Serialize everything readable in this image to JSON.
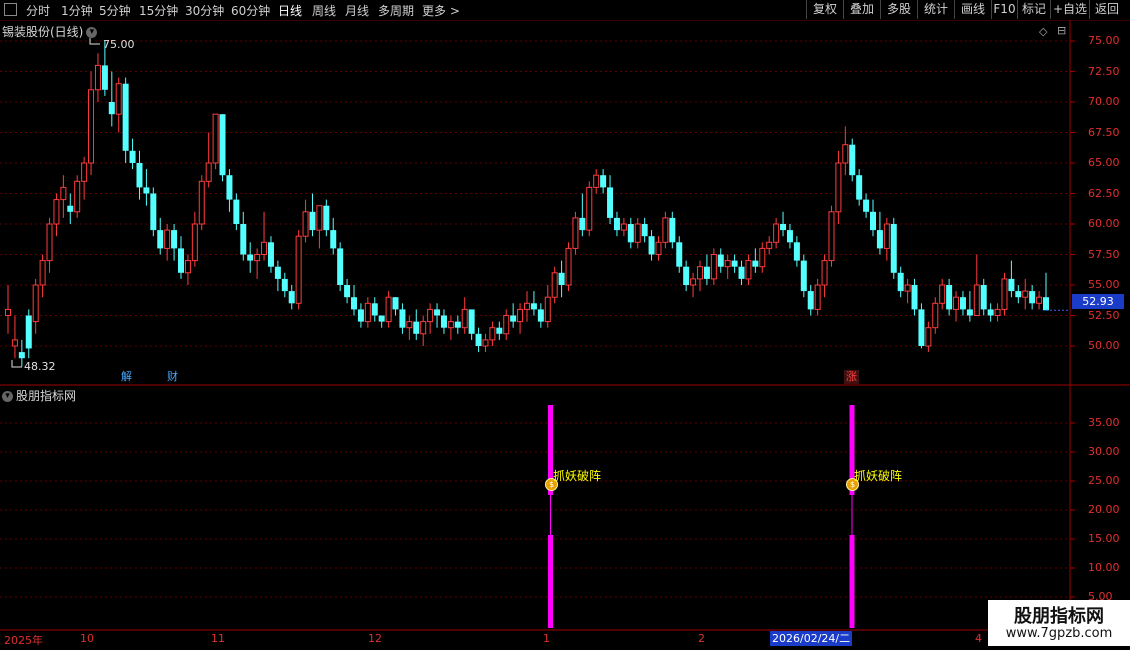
{
  "toolbar": {
    "timeframes": [
      "分时",
      "1分钟",
      "5分钟",
      "15分钟",
      "30分钟",
      "60分钟",
      "日线",
      "周线",
      "月线",
      "多周期",
      "更多 >"
    ],
    "active_timeframe": "日线",
    "right_buttons": [
      "复权",
      "叠加",
      "多股",
      "统计",
      "画线",
      "F10",
      "标记",
      "+自选",
      "返回"
    ]
  },
  "main_chart": {
    "title": "锡装股份(日线)",
    "high_label": "75.00",
    "low_label": "48.32",
    "current_price": "52.93",
    "y_ticks": [
      "75.00",
      "72.50",
      "70.00",
      "67.50",
      "65.00",
      "62.50",
      "60.00",
      "57.50",
      "55.00",
      "52.50",
      "50.00"
    ],
    "events": [
      {
        "text": "解",
        "color": "#4aa8ff"
      },
      {
        "text": "财",
        "color": "#4aa8ff"
      },
      {
        "text": "涨",
        "color": "#ff4040"
      }
    ],
    "candles": [
      [
        52.5,
        55.0,
        51.0,
        53.0
      ],
      [
        50.0,
        52.5,
        49.0,
        50.5
      ],
      [
        49.5,
        50.5,
        48.32,
        49.0
      ],
      [
        52.5,
        53.0,
        49.0,
        49.8
      ],
      [
        52.0,
        55.5,
        51.0,
        55.0
      ],
      [
        55.0,
        57.5,
        54.0,
        57.0
      ],
      [
        57.0,
        60.5,
        56.0,
        60.0
      ],
      [
        60.0,
        62.5,
        59.0,
        62.0
      ],
      [
        62.0,
        64.0,
        60.5,
        63.0
      ],
      [
        61.5,
        62.5,
        60.0,
        61.0
      ],
      [
        61.0,
        64.0,
        60.5,
        63.5
      ],
      [
        63.5,
        65.5,
        62.0,
        65.0
      ],
      [
        65.0,
        72.5,
        64.0,
        71.0
      ],
      [
        71.0,
        74.0,
        70.0,
        73.0
      ],
      [
        73.0,
        75.0,
        70.5,
        71.0
      ],
      [
        70.0,
        72.5,
        68.0,
        69.0
      ],
      [
        69.0,
        72.0,
        67.5,
        71.5
      ],
      [
        71.5,
        72.0,
        65.0,
        66.0
      ],
      [
        66.0,
        67.0,
        64.5,
        65.0
      ],
      [
        65.0,
        66.0,
        62.0,
        63.0
      ],
      [
        63.0,
        64.5,
        61.5,
        62.5
      ],
      [
        62.5,
        63.0,
        59.0,
        59.5
      ],
      [
        59.5,
        60.5,
        57.5,
        58.0
      ],
      [
        58.0,
        60.0,
        57.0,
        59.5
      ],
      [
        59.5,
        60.0,
        57.0,
        58.0
      ],
      [
        58.0,
        59.0,
        55.5,
        56.0
      ],
      [
        56.0,
        57.5,
        55.0,
        57.0
      ],
      [
        57.0,
        61.0,
        56.5,
        60.0
      ],
      [
        60.0,
        64.0,
        59.5,
        63.5
      ],
      [
        63.5,
        67.5,
        63.0,
        65.0
      ],
      [
        65.0,
        69.0,
        64.5,
        69.0
      ],
      [
        69.0,
        69.0,
        63.5,
        64.0
      ],
      [
        64.0,
        64.5,
        61.0,
        62.0
      ],
      [
        62.0,
        62.5,
        59.5,
        60.0
      ],
      [
        60.0,
        61.0,
        57.0,
        57.5
      ],
      [
        57.5,
        58.5,
        56.0,
        57.0
      ],
      [
        57.0,
        58.0,
        55.5,
        57.5
      ],
      [
        57.5,
        61.0,
        57.0,
        58.5
      ],
      [
        58.5,
        59.0,
        56.0,
        56.5
      ],
      [
        56.5,
        57.0,
        54.5,
        55.5
      ],
      [
        55.5,
        56.0,
        54.0,
        54.5
      ],
      [
        54.5,
        55.0,
        53.0,
        53.5
      ],
      [
        53.5,
        59.5,
        53.0,
        59.0
      ],
      [
        59.0,
        62.0,
        58.5,
        61.0
      ],
      [
        61.0,
        62.5,
        59.0,
        59.5
      ],
      [
        59.5,
        61.0,
        58.0,
        61.5
      ],
      [
        61.5,
        62.0,
        59.0,
        59.5
      ],
      [
        59.5,
        60.5,
        57.5,
        58.0
      ],
      [
        58.0,
        58.5,
        54.5,
        55.0
      ],
      [
        55.0,
        55.5,
        53.5,
        54.0
      ],
      [
        54.0,
        55.0,
        52.5,
        53.0
      ],
      [
        53.0,
        53.5,
        51.5,
        52.0
      ],
      [
        52.0,
        54.0,
        51.5,
        53.5
      ],
      [
        53.5,
        54.0,
        52.0,
        52.5
      ],
      [
        52.5,
        52.5,
        51.5,
        52.0
      ],
      [
        52.0,
        54.5,
        51.5,
        54.0
      ],
      [
        54.0,
        54.0,
        52.5,
        53.0
      ],
      [
        53.0,
        53.5,
        51.0,
        51.5
      ],
      [
        51.5,
        52.5,
        50.5,
        52.0
      ],
      [
        52.0,
        53.0,
        50.5,
        51.0
      ],
      [
        51.0,
        52.5,
        50.0,
        52.0
      ],
      [
        52.0,
        53.5,
        51.0,
        53.0
      ],
      [
        53.0,
        53.5,
        51.5,
        52.5
      ],
      [
        52.5,
        53.0,
        51.0,
        51.5
      ],
      [
        51.5,
        52.5,
        50.5,
        52.0
      ],
      [
        52.0,
        52.5,
        51.0,
        51.5
      ],
      [
        51.5,
        54.0,
        51.0,
        53.0
      ],
      [
        53.0,
        53.0,
        50.5,
        51.0
      ],
      [
        51.0,
        51.5,
        49.5,
        50.0
      ],
      [
        50.0,
        51.0,
        49.5,
        50.5
      ],
      [
        50.5,
        52.0,
        50.0,
        51.5
      ],
      [
        51.5,
        52.0,
        50.5,
        51.0
      ],
      [
        51.0,
        53.0,
        50.5,
        52.5
      ],
      [
        52.5,
        53.5,
        51.5,
        52.0
      ],
      [
        52.0,
        53.5,
        51.0,
        53.0
      ],
      [
        53.0,
        54.5,
        52.0,
        53.5
      ],
      [
        53.5,
        54.5,
        52.5,
        53.0
      ],
      [
        53.0,
        53.5,
        51.5,
        52.0
      ],
      [
        52.0,
        55.0,
        51.5,
        54.0
      ],
      [
        54.0,
        56.5,
        53.5,
        56.0
      ],
      [
        56.0,
        57.0,
        54.0,
        55.0
      ],
      [
        55.0,
        58.5,
        54.5,
        58.0
      ],
      [
        58.0,
        61.0,
        57.5,
        60.5
      ],
      [
        60.5,
        62.5,
        59.0,
        59.5
      ],
      [
        59.5,
        63.5,
        59.0,
        63.0
      ],
      [
        63.0,
        64.5,
        62.5,
        64.0
      ],
      [
        64.0,
        64.5,
        62.5,
        63.0
      ],
      [
        63.0,
        64.0,
        60.0,
        60.5
      ],
      [
        60.5,
        61.0,
        59.0,
        59.5
      ],
      [
        59.5,
        60.5,
        59.0,
        60.0
      ],
      [
        60.0,
        60.5,
        58.0,
        58.5
      ],
      [
        58.5,
        60.5,
        58.0,
        60.0
      ],
      [
        60.0,
        60.5,
        58.5,
        59.0
      ],
      [
        59.0,
        59.5,
        57.0,
        57.5
      ],
      [
        57.5,
        59.0,
        57.0,
        58.5
      ],
      [
        58.5,
        61.0,
        58.0,
        60.5
      ],
      [
        60.5,
        61.0,
        58.0,
        58.5
      ],
      [
        58.5,
        59.0,
        56.0,
        56.5
      ],
      [
        56.5,
        57.0,
        54.5,
        55.0
      ],
      [
        55.0,
        56.0,
        54.0,
        55.5
      ],
      [
        55.5,
        57.0,
        54.5,
        56.5
      ],
      [
        56.5,
        57.5,
        55.0,
        55.5
      ],
      [
        55.5,
        58.0,
        55.0,
        57.5
      ],
      [
        57.5,
        58.0,
        56.0,
        56.5
      ],
      [
        56.5,
        57.5,
        55.5,
        57.0
      ],
      [
        57.0,
        57.5,
        56.0,
        56.5
      ],
      [
        56.5,
        57.0,
        55.0,
        55.5
      ],
      [
        55.5,
        57.5,
        55.0,
        57.0
      ],
      [
        57.0,
        58.0,
        56.0,
        56.5
      ],
      [
        56.5,
        58.5,
        56.0,
        58.0
      ],
      [
        58.0,
        59.0,
        57.5,
        58.5
      ],
      [
        58.5,
        60.5,
        58.0,
        60.0
      ],
      [
        60.0,
        61.0,
        59.0,
        59.5
      ],
      [
        59.5,
        60.0,
        58.0,
        58.5
      ],
      [
        58.5,
        59.0,
        56.5,
        57.0
      ],
      [
        57.0,
        57.5,
        54.0,
        54.5
      ],
      [
        54.5,
        55.0,
        52.5,
        53.0
      ],
      [
        53.0,
        55.5,
        52.5,
        55.0
      ],
      [
        55.0,
        57.5,
        54.0,
        57.0
      ],
      [
        57.0,
        61.5,
        56.5,
        61.0
      ],
      [
        61.0,
        66.0,
        60.0,
        65.0
      ],
      [
        65.0,
        68.0,
        64.0,
        66.5
      ],
      [
        66.5,
        67.0,
        63.5,
        64.0
      ],
      [
        64.0,
        64.5,
        61.5,
        62.0
      ],
      [
        62.0,
        62.5,
        60.5,
        61.0
      ],
      [
        61.0,
        62.0,
        59.0,
        59.5
      ],
      [
        59.5,
        61.0,
        57.5,
        58.0
      ],
      [
        58.0,
        60.5,
        57.0,
        60.0
      ],
      [
        60.0,
        60.5,
        55.5,
        56.0
      ],
      [
        56.0,
        56.5,
        54.0,
        54.5
      ],
      [
        54.5,
        55.5,
        53.5,
        55.0
      ],
      [
        55.0,
        55.5,
        52.5,
        53.0
      ],
      [
        53.0,
        53.5,
        49.8,
        50.0
      ],
      [
        50.0,
        52.0,
        49.5,
        51.5
      ],
      [
        51.5,
        54.0,
        51.0,
        53.5
      ],
      [
        53.5,
        55.5,
        53.0,
        55.0
      ],
      [
        55.0,
        55.5,
        52.5,
        53.0
      ],
      [
        53.0,
        54.5,
        52.0,
        54.0
      ],
      [
        54.0,
        54.5,
        52.5,
        53.0
      ],
      [
        53.0,
        54.5,
        52.0,
        52.5
      ],
      [
        52.5,
        57.5,
        52.5,
        55.0
      ],
      [
        55.0,
        55.5,
        52.5,
        53.0
      ],
      [
        53.0,
        53.5,
        52.0,
        52.5
      ],
      [
        52.5,
        53.5,
        52.0,
        53.0
      ],
      [
        53.0,
        56.0,
        52.5,
        55.5
      ],
      [
        55.5,
        57.0,
        54.0,
        54.5
      ],
      [
        54.5,
        55.0,
        53.5,
        54.0
      ],
      [
        54.0,
        55.5,
        53.0,
        54.5
      ],
      [
        54.5,
        55.0,
        53.0,
        53.5
      ],
      [
        53.5,
        54.5,
        53.0,
        54.0
      ],
      [
        54.0,
        56.0,
        53.0,
        52.93
      ]
    ]
  },
  "indicator": {
    "title": "股朋指标网",
    "y_ticks": [
      "35.00",
      "30.00",
      "25.00",
      "20.00",
      "15.00",
      "10.00",
      "5.00"
    ],
    "signals": [
      {
        "label": "抓妖破阵",
        "coin": "$"
      },
      {
        "label": "抓妖破阵",
        "coin": "$"
      }
    ]
  },
  "x_axis": {
    "labels": [
      "2025年",
      "10",
      "11",
      "12",
      "1",
      "2",
      "4"
    ],
    "cursor_date": "2026/02/24/二"
  },
  "watermark": {
    "line1": "股朋指标网",
    "line2": "www.7gpzb.com"
  },
  "colors": {
    "up": "#ff3c3c",
    "down": "#54ffff",
    "grid": "#800000",
    "signal": "#ff00ff",
    "label": "#ffff00"
  }
}
